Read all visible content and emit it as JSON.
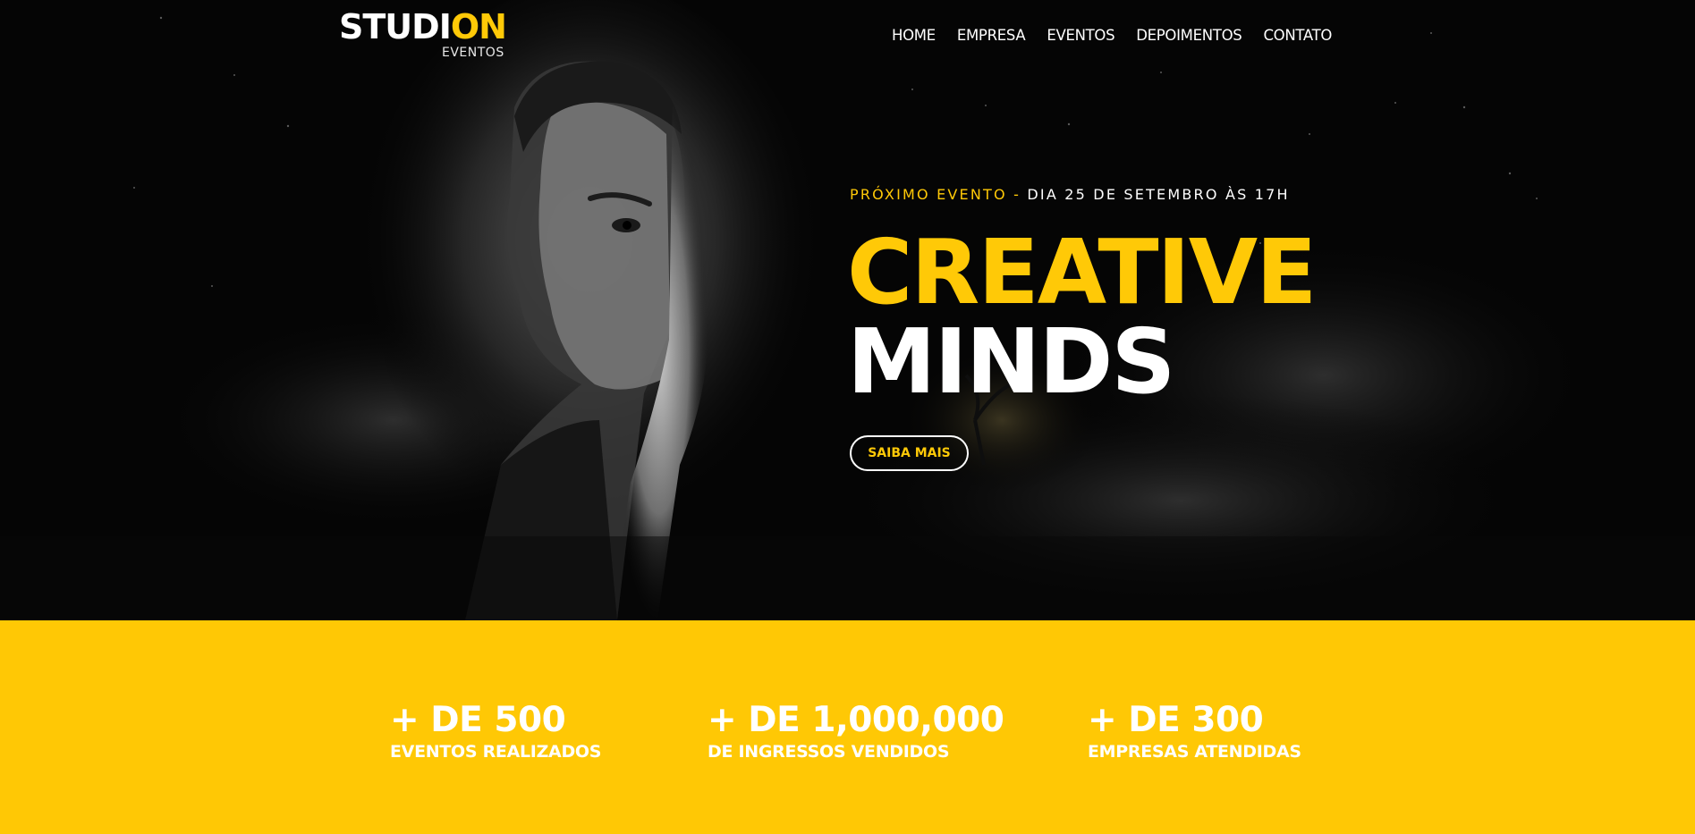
{
  "header": {
    "logo": {
      "part_white": "STUDI",
      "part_accent": "ON",
      "subtitle": "EVENTOS"
    },
    "nav": [
      "HOME",
      "EMPRESA",
      "EVENTOS",
      "DEPOIMENTOS",
      "CONTATO"
    ]
  },
  "hero": {
    "event_label": "PRÓXIMO EVENTO",
    "event_separator": "-",
    "event_date": "DIA 25 DE SETEMBRO ÀS 17H",
    "headline_line1": "CREATIVE",
    "headline_line2": "MINDS",
    "cta_label": "SAIBA MAIS"
  },
  "stats": [
    {
      "value": "+ DE 500",
      "label": "EVENTOS REALIZADOS"
    },
    {
      "value": "+ DE 1,000,000",
      "label": "DE INGRESSOS VENDIDOS"
    },
    {
      "value": "+ DE 300",
      "label": "EMPRESAS ATENDIDAS"
    }
  ],
  "colors": {
    "accent": "#ffc907",
    "hero_background": "#050505",
    "stats_background": "#ffc805",
    "text_light": "#ffffff"
  }
}
